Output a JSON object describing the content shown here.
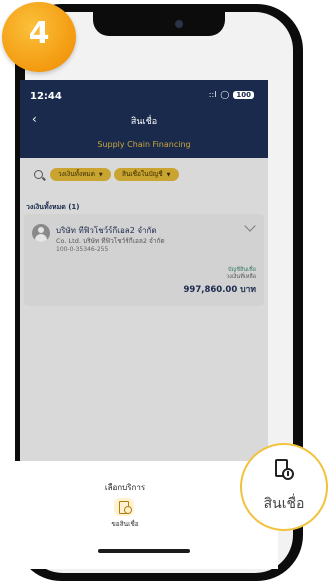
{
  "step": {
    "number": "4"
  },
  "status_bar": {
    "time": "12:44",
    "signal": "::l",
    "wifi": "wifi-icon",
    "battery": "100"
  },
  "nav": {
    "title": "สินเชื่อ",
    "subtitle": "Supply Chain Financing",
    "back_icon": "back-chevron-icon"
  },
  "filters": {
    "search_icon": "search-icon",
    "chips": [
      {
        "label": "วงเงินทั้งหมด"
      },
      {
        "label": "สินเชื่อในบัญชี"
      }
    ]
  },
  "section": {
    "label": "วงเงินทั้งหมด (1)"
  },
  "card": {
    "company": "บริษัท ทีฟิวโชว์ร์กีเอล2 จำกัด",
    "company_en": "Co. Ltd. บริษัท ทีฟิวโชว์ร์กีเอล2 จำกัด",
    "account": "100-0-35346-255",
    "limit_label": "บัญชีสินเชื่อ",
    "limit_sub": "วงเงินที่เหลือ",
    "amount": "997,860.00 บาท"
  },
  "sheet": {
    "title": "เลือกบริการ",
    "service_label": "ขอสินเชื่อ",
    "service_icon": "loan-icon"
  },
  "highlight": {
    "label": "สินเชื่อ",
    "icon": "loan-icon",
    "color": "#f2c23c"
  },
  "colors": {
    "navy": "#1a2a4c",
    "gold": "#c9a431",
    "badge": "#f39a10"
  }
}
